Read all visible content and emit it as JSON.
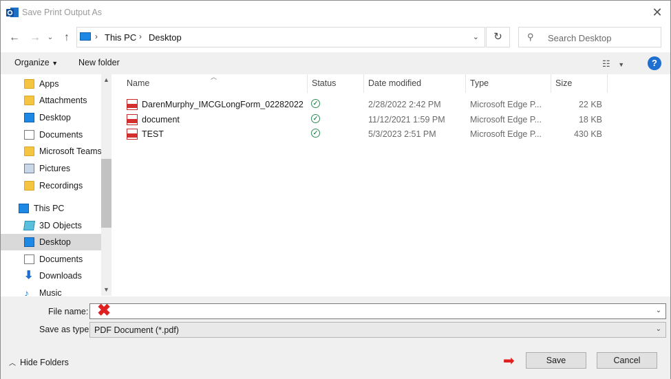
{
  "window": {
    "title": "Save Print Output As"
  },
  "address": {
    "segments": [
      "This PC",
      "Desktop"
    ]
  },
  "search": {
    "placeholder": "Search Desktop"
  },
  "toolbar": {
    "organize": "Organize",
    "new_folder": "New folder",
    "help": "?"
  },
  "sidebar": {
    "items": [
      {
        "label": "Apps",
        "icon": "folder-icon"
      },
      {
        "label": "Attachments",
        "icon": "folder-icon"
      },
      {
        "label": "Desktop",
        "icon": "desktop-icon"
      },
      {
        "label": "Documents",
        "icon": "documents-icon"
      },
      {
        "label": "Microsoft Teams",
        "icon": "folder-icon"
      },
      {
        "label": "Pictures",
        "icon": "pictures-icon"
      },
      {
        "label": "Recordings",
        "icon": "folder-icon"
      },
      {
        "label": "This PC",
        "icon": "pc-icon"
      },
      {
        "label": "3D Objects",
        "icon": "3d-objects-icon"
      },
      {
        "label": "Desktop",
        "icon": "desktop-icon",
        "selected": true
      },
      {
        "label": "Documents",
        "icon": "documents-icon"
      },
      {
        "label": "Downloads",
        "icon": "downloads-icon"
      },
      {
        "label": "Music",
        "icon": "music-icon"
      }
    ]
  },
  "columns": {
    "name": "Name",
    "status": "Status",
    "date": "Date modified",
    "type": "Type",
    "size": "Size"
  },
  "files": [
    {
      "name": "DarenMurphy_IMCGLongForm_02282022",
      "date": "2/28/2022 2:42 PM",
      "type": "Microsoft Edge P...",
      "size": "22 KB"
    },
    {
      "name": "document",
      "date": "11/12/2021 1:59 PM",
      "type": "Microsoft Edge P...",
      "size": "18 KB"
    },
    {
      "name": "TEST",
      "date": "5/3/2023 2:51 PM",
      "type": "Microsoft Edge P...",
      "size": "430 KB"
    }
  ],
  "form": {
    "file_name_label": "File name:",
    "file_name_value": "",
    "save_type_label": "Save as type:",
    "save_type_value": "PDF Document (*.pdf)"
  },
  "footer": {
    "hide_folders": "Hide Folders",
    "save": "Save",
    "cancel": "Cancel"
  },
  "colors": {
    "accent": "#1e6fd0",
    "annotation": "#e02020",
    "status_ok": "#2e8b57"
  }
}
